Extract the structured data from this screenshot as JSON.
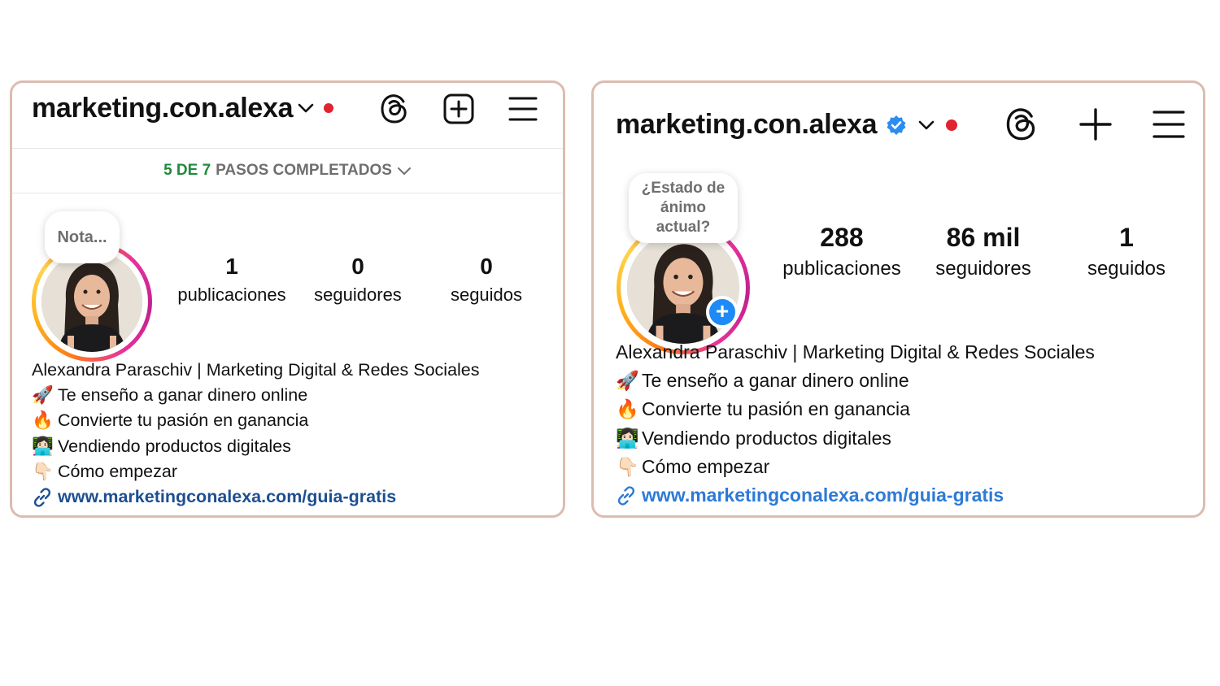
{
  "left": {
    "username": "marketing.con.alexa",
    "steps": {
      "green": "5 DE 7",
      "rest": "PASOS COMPLETADOS"
    },
    "note": "Nota...",
    "stats": [
      {
        "num": "1",
        "label": "publicaciones"
      },
      {
        "num": "0",
        "label": "seguidores"
      },
      {
        "num": "0",
        "label": "seguidos"
      }
    ],
    "bio": {
      "name": "Alexandra Paraschiv | Marketing Digital & Redes Sociales",
      "lines": [
        {
          "emoji": "🚀",
          "text": "Te enseño a ganar dinero online"
        },
        {
          "emoji": "🔥",
          "text": "Convierte tu pasión en ganancia"
        },
        {
          "emoji": "👩🏻‍💻",
          "text": "Vendiendo productos digitales"
        },
        {
          "emoji": "👇🏻",
          "text": "Cómo empezar"
        }
      ],
      "link": "www.marketingconalexa.com/guia-gratis"
    },
    "icons": [
      "chevron-down-icon",
      "threads-icon",
      "new-post-icon",
      "menu-icon",
      "link-icon"
    ]
  },
  "right": {
    "username": "marketing.con.alexa",
    "note": "¿Estado de ánimo actual?",
    "stats": [
      {
        "num": "288",
        "label": "publicaciones"
      },
      {
        "num": "86 mil",
        "label": "seguidores"
      },
      {
        "num": "1",
        "label": "seguidos"
      }
    ],
    "bio": {
      "name": "Alexandra Paraschiv | Marketing Digital & Redes Sociales",
      "lines": [
        {
          "emoji": "🚀",
          "text": "Te enseño a ganar dinero online"
        },
        {
          "emoji": "🔥",
          "text": "Convierte tu pasión en ganancia"
        },
        {
          "emoji": "👩🏻‍💻",
          "text": "Vendiendo productos digitales"
        },
        {
          "emoji": "👇🏻",
          "text": "Cómo empezar"
        }
      ],
      "link": "www.marketingconalexa.com/guia-gratis"
    },
    "add_story": "+",
    "icons": [
      "verified-badge-icon",
      "chevron-down-icon",
      "threads-icon",
      "plus-icon",
      "menu-icon",
      "link-icon"
    ]
  },
  "colors": {
    "card_border": "#dcbcb0",
    "notification_dot": "#e0232e",
    "steps_green": "#1f8a3b",
    "link": "#1d4f91",
    "verified": "#2d8cf0"
  }
}
